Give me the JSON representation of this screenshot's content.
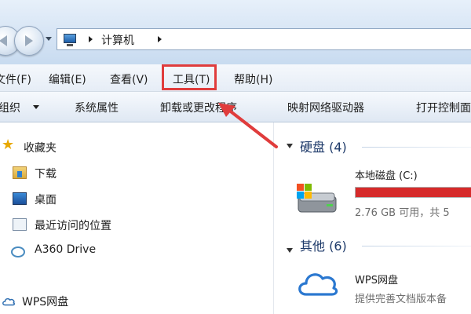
{
  "address_bar": {
    "breadcrumb": "计算机"
  },
  "menu": {
    "items": [
      "文件(F)",
      "编辑(E)",
      "查看(V)",
      "工具(T)",
      "帮助(H)"
    ],
    "highlighted_item": "工具(T)",
    "highlight_color": "#e03c3c"
  },
  "toolbar": {
    "items": [
      "组织",
      "系统属性",
      "卸载或更改程序",
      "映射网络驱动器",
      "打开控制面"
    ]
  },
  "sidebar": {
    "favorites": "收藏夹",
    "items": [
      "下载",
      "桌面",
      "最近访问的位置",
      "A360 Drive"
    ],
    "wps": "WPS网盘",
    "icons": [
      "star-icon",
      "downloads-folder-icon",
      "desktop-icon",
      "recent-places-icon",
      "a360-drive-icon",
      "cloud-icon"
    ]
  },
  "content": {
    "hard_disks_title": "硬盘 (4)",
    "drive_c": {
      "label": "本地磁盘 (C:)",
      "space": "2.76 GB 可用，共 5",
      "used_fraction": 0.98,
      "bar_color": "#d62a2a"
    },
    "other_title": "其他 (6)",
    "wps_drive": {
      "label": "WPS网盘",
      "desc": "提供完善文档版本备"
    }
  }
}
